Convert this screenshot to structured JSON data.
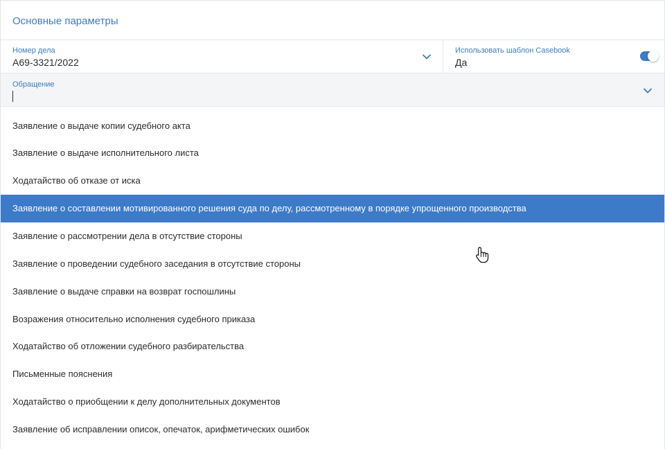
{
  "section": {
    "title": "Основные параметры"
  },
  "case_field": {
    "label": "Номер дела",
    "value": "А69-3321/2022",
    "icon": "chevron-down-icon"
  },
  "template_field": {
    "label": "Использовать шаблон Casebook",
    "value": "Да",
    "enabled": true
  },
  "request_field": {
    "label": "Обращение",
    "value": "",
    "icon": "chevron-down-icon"
  },
  "dropdown": {
    "selected_index": 3,
    "options": [
      "Заявление о выдаче копии судебного акта",
      "Заявление о выдаче исполнительного листа",
      "Ходатайство об отказе от иска",
      "Заявление о составлении мотивированного решения суда по делу, рассмотренному в порядке упрощенного производства",
      "Заявление о рассмотрении дела в отсутствие стороны",
      "Заявление о проведении судебного заседания в отсутствие стороны",
      "Заявление о выдаче справки на возврат госпошлины",
      "Возражения относительно исполнения судебного приказа",
      "Ходатайство об отложении судебного разбирательства",
      "Письменные пояснения",
      "Ходатайство о приобщении к делу дополнительных документов",
      "Заявление об исправлении описок, опечаток, арифметических ошибок"
    ]
  },
  "colors": {
    "accent": "#3d7ac7",
    "text": "#2b2b2b",
    "border": "#e3e6ea",
    "input_bg": "#f4f5f7"
  },
  "cursor": {
    "icon": "hand-pointer-icon"
  }
}
